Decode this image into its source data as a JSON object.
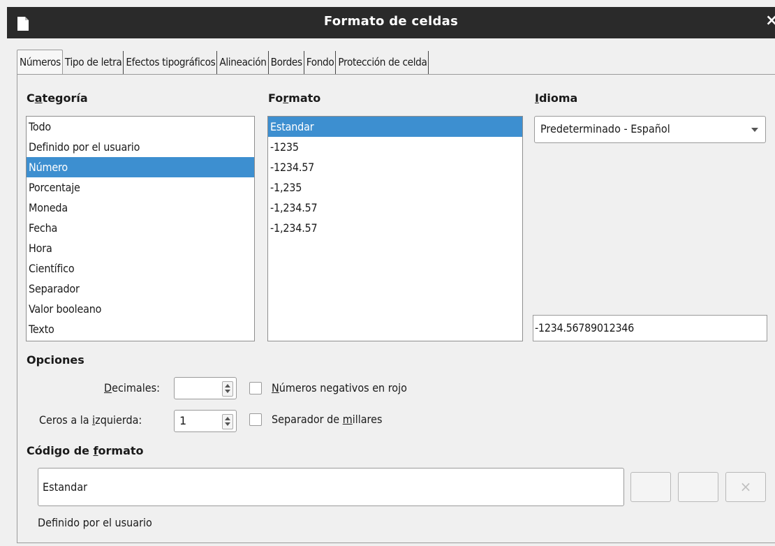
{
  "window": {
    "title": "Formato de celdas",
    "close_glyph": "×",
    "icons": {
      "doc": "document-icon",
      "close": "close-icon"
    }
  },
  "tabs": [
    {
      "label": "Números",
      "active": true
    },
    {
      "label": "Tipo de letra",
      "active": false
    },
    {
      "label": "Efectos tipográficos",
      "active": false
    },
    {
      "label": "Alineación",
      "active": false
    },
    {
      "label": "Bordes",
      "active": false
    },
    {
      "label": "Fondo",
      "active": false
    },
    {
      "label": "Protección de celda",
      "active": false
    }
  ],
  "categoria": {
    "label_pre": "C",
    "label_mn": "a",
    "label_post": "tegoría",
    "items": [
      "Todo",
      "Definido por el usuario",
      "Número",
      "Porcentaje",
      "Moneda",
      "Fecha",
      "Hora",
      "Científico",
      "Separador",
      "Valor booleano",
      "Texto"
    ],
    "selected_index": 2
  },
  "formato": {
    "label_pre": "Fo",
    "label_mn": "r",
    "label_post": "mato",
    "items": [
      "Estandar",
      "-1235",
      "-1234.57",
      "-1,235",
      "-1,234.57",
      "-1,234.57"
    ],
    "selected_index": 0
  },
  "idioma": {
    "label_mn": "I",
    "label_post": "dioma",
    "selected": "Predeterminado - Español"
  },
  "preview_value": "-1234.56789012346",
  "opciones": {
    "label": "Opciones",
    "decimales": {
      "label_mn": "D",
      "label_post": "ecimales:",
      "value": ""
    },
    "ceros": {
      "label_pre": "Ceros a la ",
      "label_mn": "i",
      "label_post": "zquierda:",
      "value": "1"
    },
    "negativos_rojo": {
      "label_mn": "N",
      "label_post": "úmeros negativos en rojo",
      "checked": false
    },
    "separador_millares": {
      "label_pre": "Separador de ",
      "label_mn": "m",
      "label_post": "illares",
      "checked": false
    }
  },
  "codigo": {
    "label_pre": "Código de ",
    "label_mn": "f",
    "label_post": "ormato",
    "value": "Estandar",
    "description": "Definido por el usuario",
    "delete_glyph": "×"
  },
  "colors": {
    "selection": "#3d8fd0",
    "titlebar": "#2a2a2a"
  }
}
